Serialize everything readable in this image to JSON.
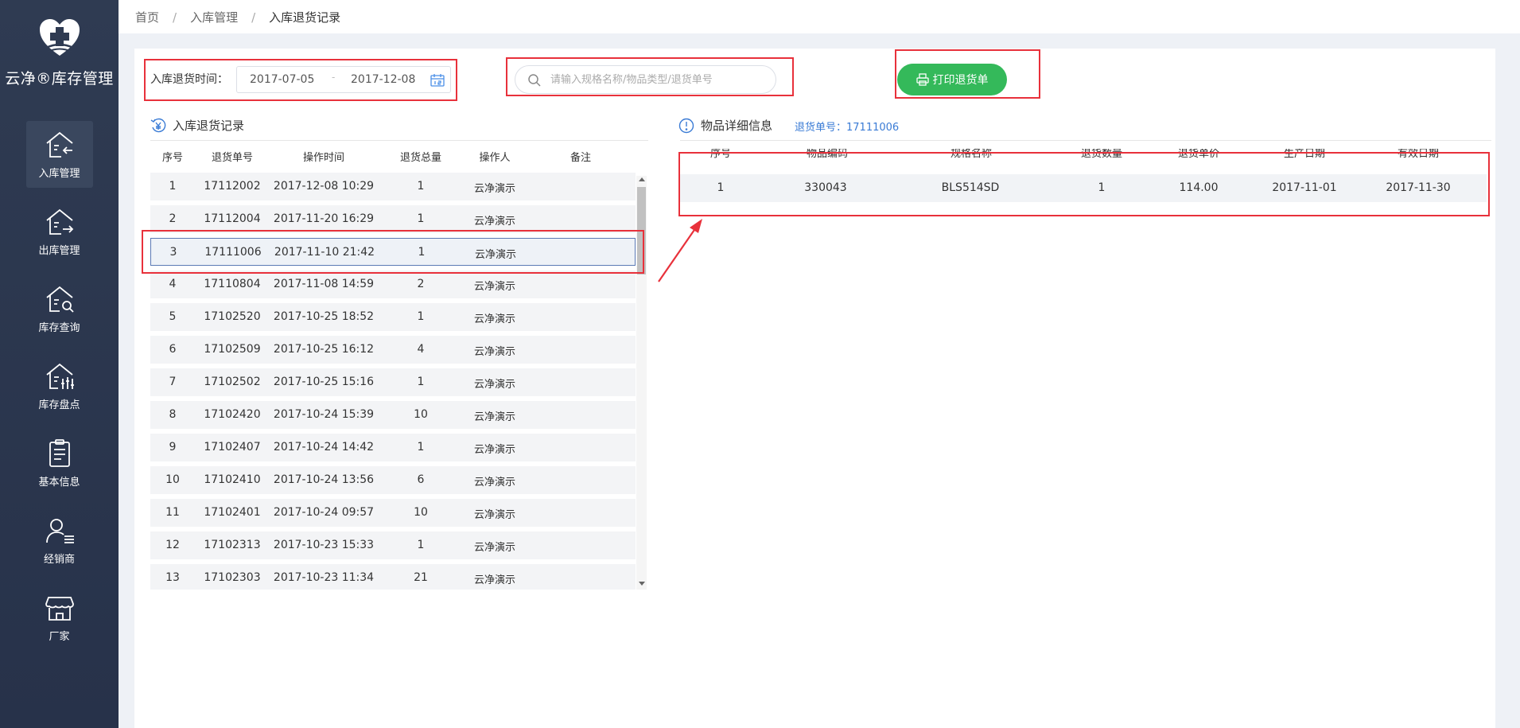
{
  "app": {
    "logo_text": "云净®库存管理"
  },
  "sidebar": {
    "items": [
      {
        "label": "入库管理",
        "icon": "inbound-house-icon",
        "active": true
      },
      {
        "label": "出库管理",
        "icon": "outbound-house-icon",
        "active": false
      },
      {
        "label": "库存查询",
        "icon": "stock-search-icon",
        "active": false
      },
      {
        "label": "库存盘点",
        "icon": "stock-check-icon",
        "active": false
      },
      {
        "label": "基本信息",
        "icon": "clipboard-icon",
        "active": false
      },
      {
        "label": "经销商",
        "icon": "dealer-user-icon",
        "active": false
      },
      {
        "label": "厂家",
        "icon": "store-icon",
        "active": false
      }
    ]
  },
  "breadcrumb": {
    "items": [
      "首页",
      "入库管理",
      "入库退货记录"
    ],
    "separator": "/"
  },
  "filters": {
    "date_label": "入库退货时间：",
    "date_start": "2017-07-05",
    "date_separator": "-",
    "date_end": "2017-12-08",
    "search_placeholder": "请输入规格名称/物品类型/退货单号"
  },
  "toolbar": {
    "print_label": "打印退货单"
  },
  "records": {
    "title": "入库退货记录",
    "columns": [
      "序号",
      "退货单号",
      "操作时间",
      "退货总量",
      "操作人",
      "备注"
    ],
    "selected_index": 2,
    "rows": [
      [
        "1",
        "17112002",
        "2017-12-08 10:29",
        "1",
        "云净演示",
        ""
      ],
      [
        "2",
        "17112004",
        "2017-11-20 16:29",
        "1",
        "云净演示",
        ""
      ],
      [
        "3",
        "17111006",
        "2017-11-10 21:42",
        "1",
        "云净演示",
        ""
      ],
      [
        "4",
        "17110804",
        "2017-11-08 14:59",
        "2",
        "云净演示",
        ""
      ],
      [
        "5",
        "17102520",
        "2017-10-25 18:52",
        "1",
        "云净演示",
        ""
      ],
      [
        "6",
        "17102509",
        "2017-10-25 16:12",
        "4",
        "云净演示",
        ""
      ],
      [
        "7",
        "17102502",
        "2017-10-25 15:16",
        "1",
        "云净演示",
        ""
      ],
      [
        "8",
        "17102420",
        "2017-10-24 15:39",
        "10",
        "云净演示",
        ""
      ],
      [
        "9",
        "17102407",
        "2017-10-24 14:42",
        "1",
        "云净演示",
        ""
      ],
      [
        "10",
        "17102410",
        "2017-10-24 13:56",
        "6",
        "云净演示",
        ""
      ],
      [
        "11",
        "17102401",
        "2017-10-24 09:57",
        "10",
        "云净演示",
        ""
      ],
      [
        "12",
        "17102313",
        "2017-10-23 15:33",
        "1",
        "云净演示",
        ""
      ],
      [
        "13",
        "17102303",
        "2017-10-23 11:34",
        "21",
        "云净演示",
        ""
      ]
    ]
  },
  "details": {
    "title": "物品详细信息",
    "return_no": "退货单号：17111006",
    "columns": [
      "序号",
      "物品编码",
      "规格名称",
      "退货数量",
      "退货单价",
      "生产日期",
      "有效日期"
    ],
    "rows": [
      [
        "1",
        "330043",
        "BLS514SD",
        "1",
        "114.00",
        "2017-11-01",
        "2017-11-30"
      ]
    ]
  },
  "colors": {
    "sidebar": "#2f3b52",
    "accent_green": "#34b95a",
    "highlight_red": "#e8313b",
    "link_blue": "#3a7bd5"
  }
}
